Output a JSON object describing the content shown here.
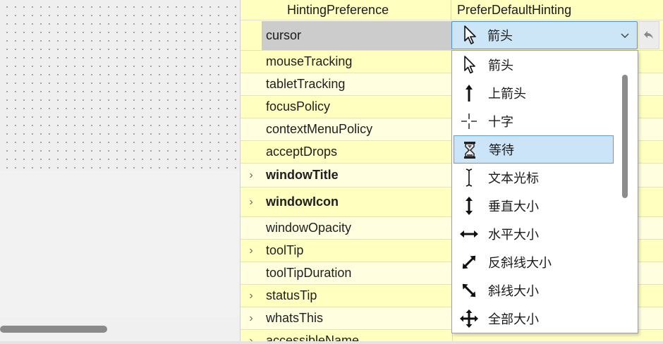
{
  "header": {
    "name": "HintingPreference",
    "value": "PreferDefaultHinting"
  },
  "cursor_row": {
    "name": "cursor"
  },
  "combo": {
    "value": "箭头",
    "icon": "arrow-cursor-icon"
  },
  "properties": [
    {
      "name": "mouseTracking",
      "expandable": false,
      "bold": false
    },
    {
      "name": "tabletTracking",
      "expandable": false,
      "bold": false
    },
    {
      "name": "focusPolicy",
      "expandable": false,
      "bold": false
    },
    {
      "name": "contextMenuPolicy",
      "expandable": false,
      "bold": false
    },
    {
      "name": "acceptDrops",
      "expandable": false,
      "bold": false
    },
    {
      "name": "windowTitle",
      "expandable": true,
      "bold": true
    },
    {
      "name": "windowIcon",
      "expandable": true,
      "bold": true
    },
    {
      "name": "windowOpacity",
      "expandable": false,
      "bold": false
    },
    {
      "name": "toolTip",
      "expandable": true,
      "bold": false
    },
    {
      "name": "toolTipDuration",
      "expandable": false,
      "bold": false
    },
    {
      "name": "statusTip",
      "expandable": true,
      "bold": false
    },
    {
      "name": "whatsThis",
      "expandable": true,
      "bold": false
    },
    {
      "name": "accessibleName",
      "expandable": true,
      "bold": false
    }
  ],
  "cursor_options": [
    {
      "label": "箭头",
      "icon": "arrow-cursor-icon"
    },
    {
      "label": "上箭头",
      "icon": "up-arrow-cursor-icon"
    },
    {
      "label": "十字",
      "icon": "crosshair-cursor-icon"
    },
    {
      "label": "等待",
      "icon": "hourglass-icon",
      "selected": true
    },
    {
      "label": "文本光标",
      "icon": "ibeam-cursor-icon"
    },
    {
      "label": "垂直大小",
      "icon": "resize-vertical-icon"
    },
    {
      "label": "水平大小",
      "icon": "resize-horizontal-icon"
    },
    {
      "label": "反斜线大小",
      "icon": "resize-diagonal-backslash-icon"
    },
    {
      "label": "斜线大小",
      "icon": "resize-diagonal-slash-icon"
    },
    {
      "label": "全部大小",
      "icon": "resize-all-icon"
    }
  ],
  "colors": {
    "row_yellow": "#ffffbf",
    "row_light": "#ffffdf",
    "selection": "#cce4f7",
    "accent": "#4a90d9"
  }
}
